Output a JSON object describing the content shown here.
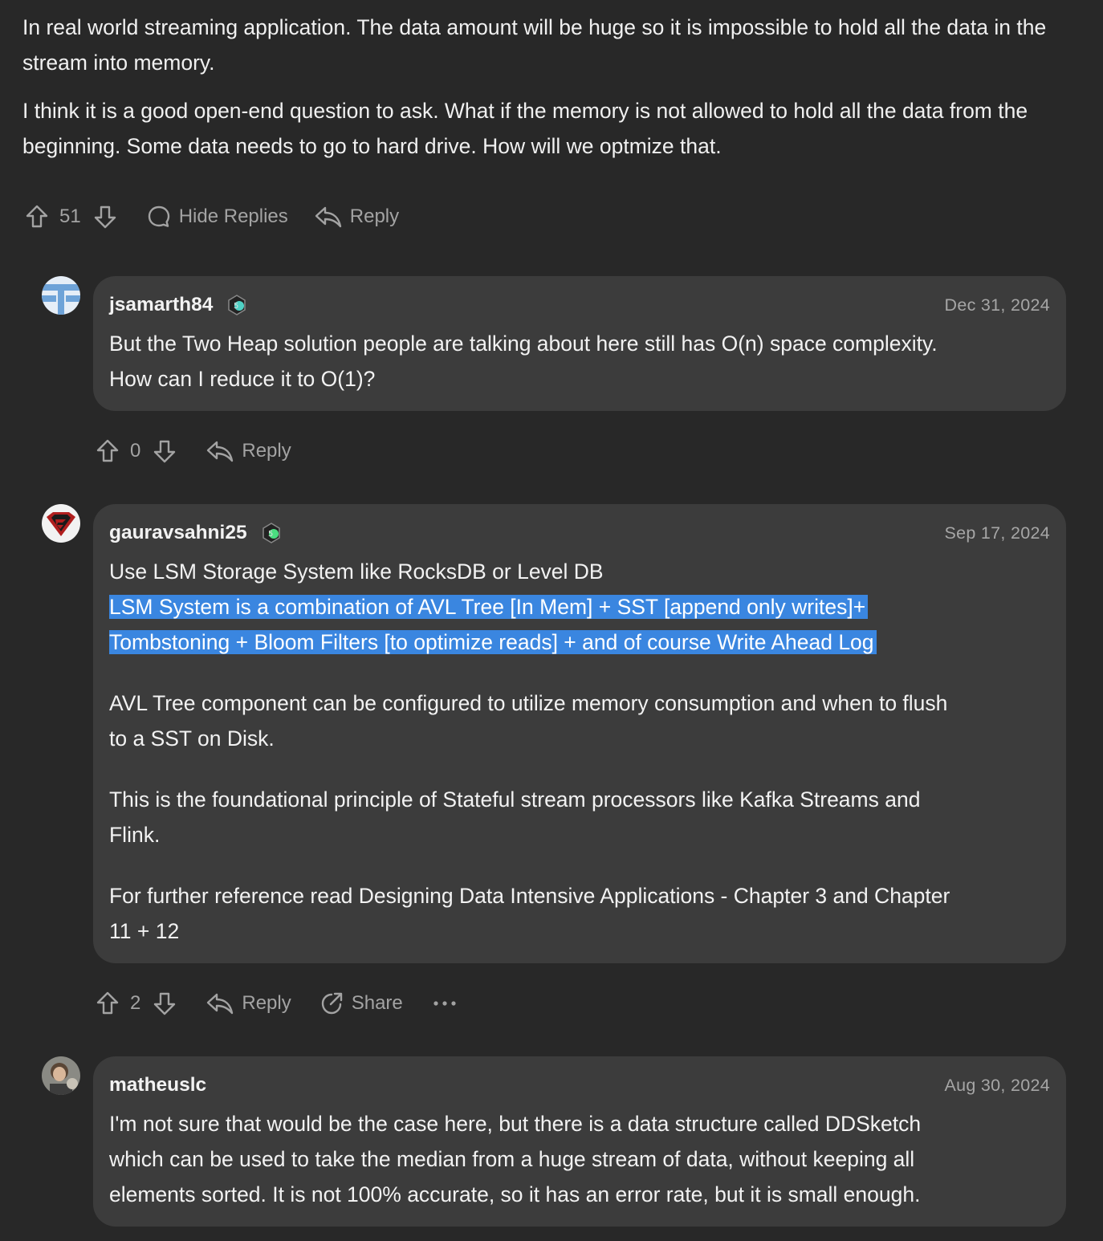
{
  "top_comment": {
    "paragraphs": [
      "In real world streaming application. The data amount will be huge so it is impossible to hold all the data in the stream into memory.",
      "I think it is a good open-end question to ask. What if the memory is not allowed to hold all the data from the beginning. Some data needs to go to hard drive. How will we optmize that."
    ],
    "votes": "51",
    "hide_replies_label": "Hide Replies",
    "reply_label": "Reply"
  },
  "replies": [
    {
      "username": "jsamarth84",
      "date": "Dec 31, 2024",
      "lines": [
        "But the Two Heap solution people are talking about here still has O(n) space complexity.",
        "How can I reduce it to O(1)?"
      ],
      "votes": "0",
      "reply_label": "Reply",
      "badge_color": "#4fd1c5"
    },
    {
      "username": "gauravsahni25",
      "date": "Sep 17, 2024",
      "line1": "Use LSM Storage System like RocksDB or Level DB",
      "highlight_1": "LSM System is a combination of AVL Tree [In Mem] + SST [append only writes]+",
      "highlight_2": "Tombstoning + Bloom Filters [to optimize reads] + and of course Write Ahead Log",
      "para2_1": "AVL Tree component can be configured to utilize memory consumption and when to flush",
      "para2_2": "to a SST on Disk.",
      "para3_1": "This is the foundational principle of Stateful stream processors like Kafka Streams and",
      "para3_2": "Flink.",
      "para4_1": "For further reference read Designing Data Intensive Applications - Chapter 3 and Chapter",
      "para4_2": "11 + 12",
      "votes": "2",
      "reply_label": "Reply",
      "share_label": "Share",
      "badge_color": "#4ade80",
      "highlight_color": "#3a86e0"
    },
    {
      "username": "matheuslc",
      "date": "Aug 30, 2024",
      "lines": [
        "I'm not sure that would be the case here, but there is a data structure called DDSketch",
        "which can be used to take the median from a huge stream of data, without keeping all",
        "elements sorted. It is not 100% accurate, so it has an error rate, but it is small enough."
      ]
    }
  ],
  "icons": [
    "upvote-icon",
    "downvote-icon",
    "comment-bubble-icon",
    "reply-arrow-icon",
    "share-icon",
    "more-icon"
  ]
}
